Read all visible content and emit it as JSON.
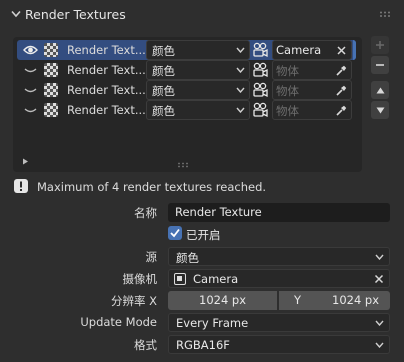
{
  "panel": {
    "title": "Render Textures",
    "icons": {
      "collapse": "chevron-down-icon",
      "grip": "drag-grip-icon"
    }
  },
  "list": {
    "items": [
      {
        "name": "Render Text...",
        "source": "颜色",
        "object_value": "Camera",
        "object_placeholder": "",
        "selected": true
      },
      {
        "name": "Render Text...",
        "source": "颜色",
        "object_value": "",
        "object_placeholder": "物体",
        "selected": false
      },
      {
        "name": "Render Text...",
        "source": "颜色",
        "object_value": "",
        "object_placeholder": "物体",
        "selected": false
      },
      {
        "name": "Render Text...",
        "source": "颜色",
        "object_value": "",
        "object_placeholder": "物体",
        "selected": false
      }
    ]
  },
  "side_buttons": {
    "add": "+",
    "remove": "−",
    "move_up": "▲",
    "move_down": "▼"
  },
  "warning": "Maximum of 4 render textures reached.",
  "props": {
    "name_label": "名称",
    "name_value": "Render Texture",
    "enabled_label": "已开启",
    "enabled": true,
    "source_label": "源",
    "source_value": "颜色",
    "camera_label": "摄像机",
    "camera_value": "Camera",
    "resolution_label": "分辨率 X",
    "res_x": "1024 px",
    "res_y_label": "Y",
    "res_y": "1024 px",
    "update_mode_label": "Update Mode",
    "update_mode_value": "Every Frame",
    "format_label": "格式",
    "format_value": "RGBA16F"
  },
  "colors": {
    "accent": "#4772b3",
    "selection": "#334d80",
    "background": "#2e2e2e"
  }
}
